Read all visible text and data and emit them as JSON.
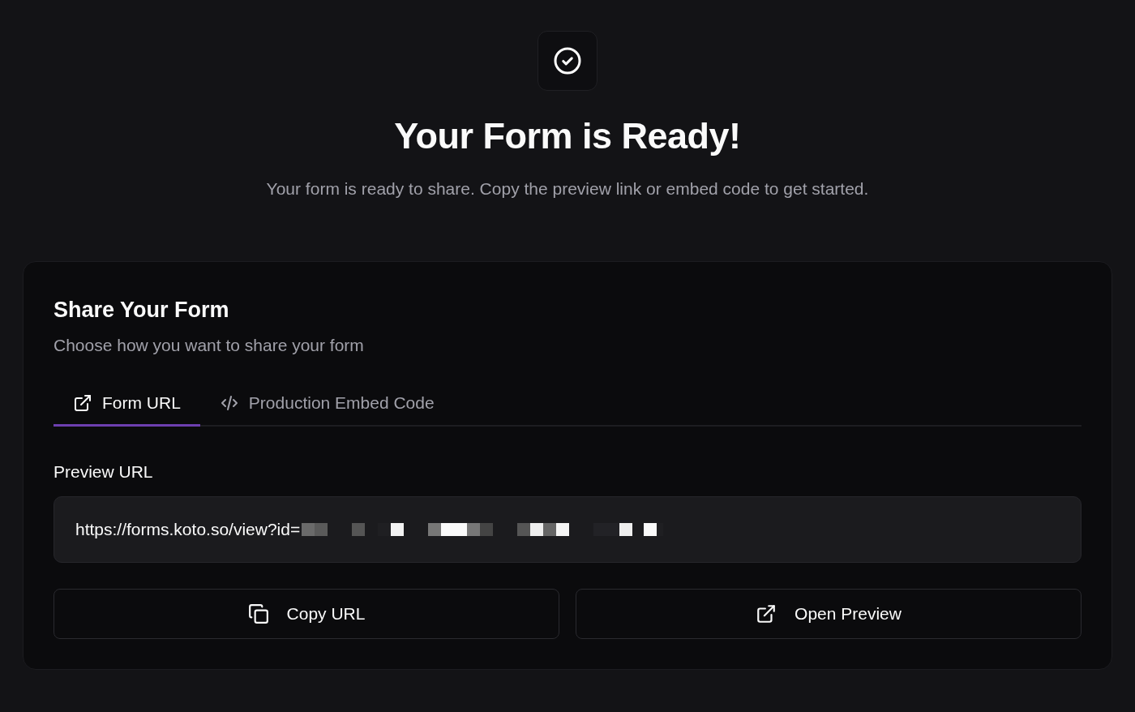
{
  "header": {
    "title": "Your Form is Ready!",
    "subtitle": "Your form is ready to share. Copy the preview link or embed code to get started."
  },
  "share_card": {
    "title": "Share Your Form",
    "subtitle": "Choose how you want to share your form",
    "tabs": [
      {
        "label": "Form URL",
        "kind": "link",
        "selected": true
      },
      {
        "label": "Production Embed Code",
        "kind": "code",
        "selected": false
      }
    ],
    "field": {
      "label": "Preview URL",
      "value": "https://forms.koto.so/view?id="
    },
    "buttons": [
      {
        "label": "Copy URL",
        "kind": "copy"
      },
      {
        "label": "Open Preview",
        "kind": "link"
      }
    ]
  }
}
